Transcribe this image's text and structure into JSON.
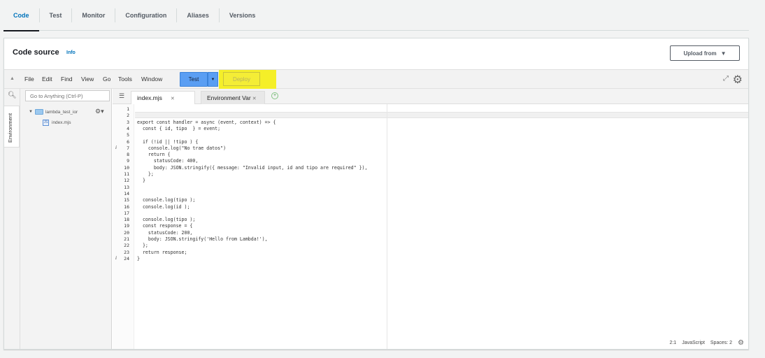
{
  "tabs": [
    "Code",
    "Test",
    "Monitor",
    "Configuration",
    "Aliases",
    "Versions"
  ],
  "panel": {
    "title": "Code source",
    "info": "Info",
    "upload_button": "Upload from"
  },
  "menu": [
    "File",
    "Edit",
    "Find",
    "View",
    "Go",
    "Tools",
    "Window"
  ],
  "toolbar": {
    "test_label": "Test",
    "deploy_label": "Deploy",
    "deploy_highlight_color": "#f5ef28"
  },
  "sidebar": {
    "search_placeholder": "Go to Anything (Ctrl-P)",
    "environment_label": "Environment",
    "folder_name": "lambda_test_ior",
    "file_name": "index.mjs"
  },
  "editor_tabs": [
    {
      "label": "index.mjs"
    },
    {
      "label": "Environment Var"
    }
  ],
  "code_lines": [
    "",
    "",
    "export const handler = async (event, context) => {",
    "  const { id, tipo  } = event;",
    "",
    "  if (!id || !tipo ) {",
    "    console.log(\"No trae datos\")",
    "    return {",
    "      statusCode: 400,",
    "      body: JSON.stringify({ message: \"Invalid input, id and tipo are required\" }),",
    "    };",
    "  }",
    "",
    "",
    "  console.log(tipo );",
    "  console.log(id );",
    "",
    "  console.log(tipo );",
    "  const response = {",
    "    statusCode: 200,",
    "    body: JSON.stringify('Hello from Lambda!'),",
    "  };",
    "  return response;",
    "}"
  ],
  "hint_lines": [
    7,
    24
  ],
  "status": {
    "position": "2:1",
    "language": "JavaScript",
    "spaces": "Spaces: 2"
  }
}
